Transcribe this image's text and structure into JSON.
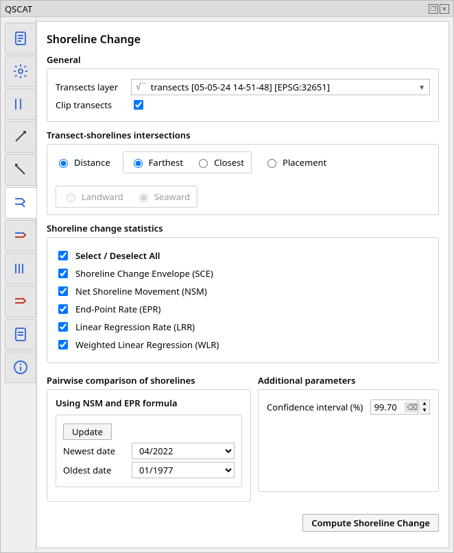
{
  "window": {
    "title": "QSCAT"
  },
  "sidebar": {
    "tabs": [
      "project",
      "settings",
      "baseline",
      "transects-up",
      "transects-down",
      "shoreline-change",
      "compare",
      "multi",
      "summary",
      "report",
      "info"
    ],
    "active_index": 5
  },
  "page": {
    "title": "Shoreline Change",
    "general_label": "General",
    "transects_layer_label": "Transects layer",
    "transects_layer_value": "transects [05-05-24 14-51-48] [EPSG:32651]",
    "clip_transects_label": "Clip transects",
    "clip_transects_checked": true,
    "intersections_label": "Transect-shorelines intersections",
    "by_distance_label": "Distance",
    "by_placement_label": "Placement",
    "distance_selected": true,
    "farthest_label": "Farthest",
    "closest_label": "Closest",
    "farthest_selected": true,
    "landward_label": "Landward",
    "seaward_label": "Seaward",
    "seaward_selected": true,
    "stats_label": "Shoreline change statistics",
    "select_all_label": "Select / Deselect All",
    "select_all_checked": true,
    "stats": [
      {
        "label": "Shoreline Change Envelope (SCE)",
        "checked": true
      },
      {
        "label": "Net Shoreline Movement (NSM)",
        "checked": true
      },
      {
        "label": "End-Point Rate (EPR)",
        "checked": true
      },
      {
        "label": "Linear Regression Rate (LRR)",
        "checked": true
      },
      {
        "label": "Weighted Linear Regression (WLR)",
        "checked": true
      }
    ],
    "pairwise_label": "Pairwise comparison of shorelines",
    "pairwise_formula_label": "Using NSM and EPR formula",
    "update_label": "Update",
    "newest_date_label": "Newest date",
    "newest_date_value": "04/2022",
    "oldest_date_label": "Oldest date",
    "oldest_date_value": "01/1977",
    "additional_label": "Additional parameters",
    "confidence_label": "Confidence interval (%)",
    "confidence_value": "99.70",
    "compute_label": "Compute Shoreline Change"
  }
}
